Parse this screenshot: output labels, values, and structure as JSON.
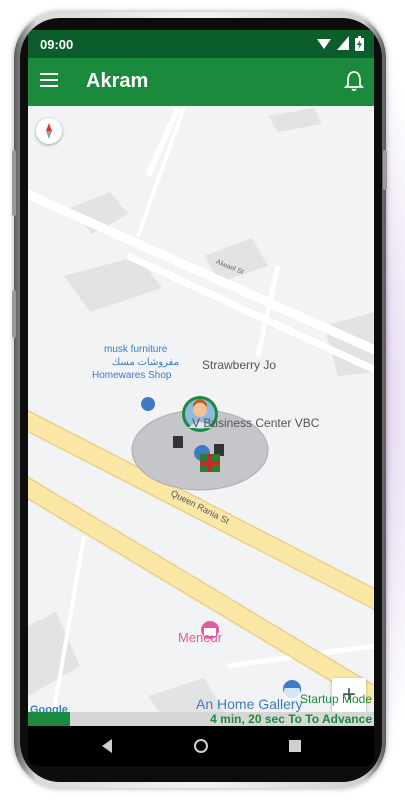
{
  "status_bar": {
    "time": "09:00"
  },
  "app_bar": {
    "title": "Akram"
  },
  "map": {
    "places": {
      "musk_en": "musk furniture",
      "musk_ar": "مفروشات مسك",
      "homewares": "Homewares Shop",
      "strawberry": "Strawberry Jo",
      "business": "V Business Center VBC",
      "meneur": "Meneur",
      "gallery": "An Home Gallery"
    },
    "streets": {
      "top": "Alwael St",
      "main": "Queen Rania St"
    },
    "zoom_in": "+",
    "zoom_out": "−",
    "google": "Google"
  },
  "hud": {
    "mode": "Startup Mode",
    "timer": "4 min, 20 sec To To Advance"
  },
  "colors": {
    "status_bar": "#0b5d2c",
    "app_bar": "#1c8a3d",
    "road": "#fbe7a6",
    "poi_blue": "#3f7ac4",
    "poi_pink": "#e55aa0"
  }
}
